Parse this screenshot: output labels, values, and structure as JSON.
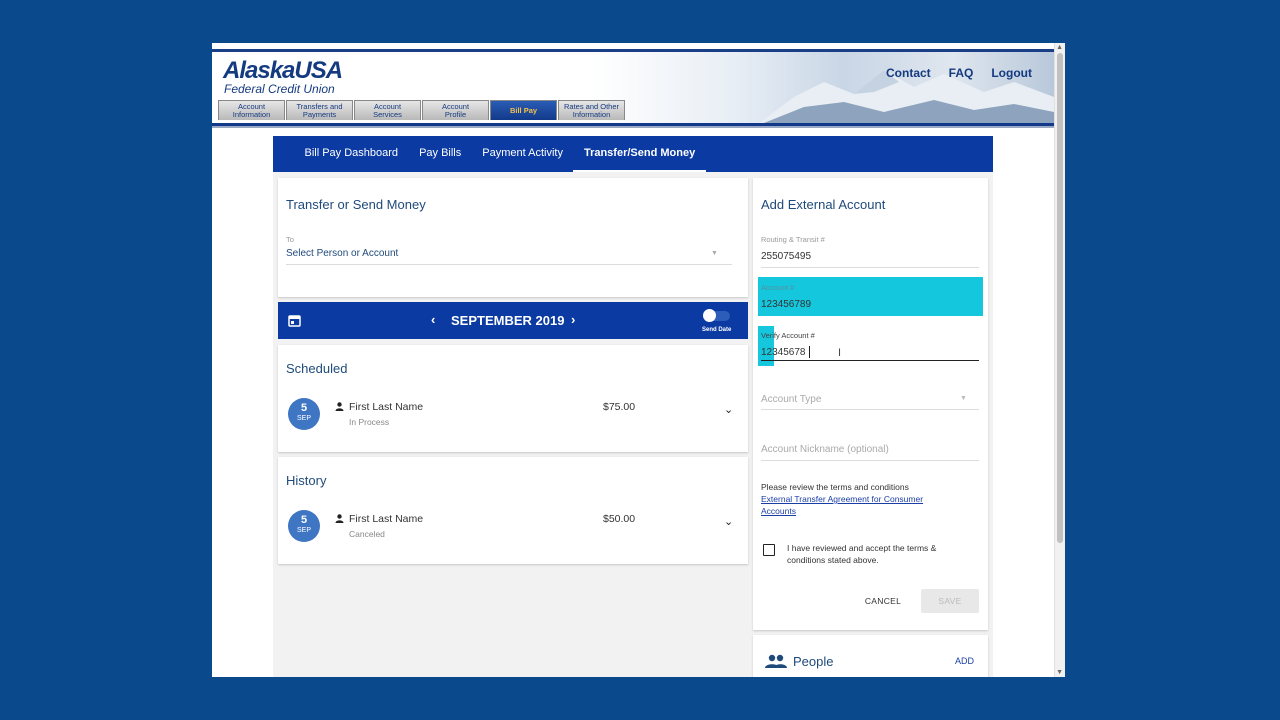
{
  "header": {
    "logo_main": "AlaskaUSA",
    "logo_sub": "Federal Credit Union",
    "links": [
      "Contact",
      "FAQ",
      "Logout"
    ],
    "tabs": [
      "Account\nInformation",
      "Transfers and\nPayments",
      "Account\nServices",
      "Account\nProfile",
      "Bill Pay",
      "Rates and Other\nInformation"
    ]
  },
  "subnav": [
    "Bill Pay Dashboard",
    "Pay Bills",
    "Payment Activity",
    "Transfer/Send Money"
  ],
  "transfer": {
    "title": "Transfer or Send Money",
    "to_label": "To",
    "to_placeholder": "Select Person or Account"
  },
  "calendar": {
    "month": "SEPTEMBER 2019",
    "toggle_label": "Send Date"
  },
  "scheduled": {
    "title": "Scheduled",
    "day": "5",
    "mon": "SEP",
    "name": "First Last Name",
    "status": "In Process",
    "amount": "$75.00"
  },
  "history": {
    "title": "History",
    "day": "5",
    "mon": "SEP",
    "name": "First Last Name",
    "status": "Canceled",
    "amount": "$50.00"
  },
  "external": {
    "title": "Add External Account",
    "routing_label": "Routing & Transit #",
    "routing_value": "255075495",
    "account_label": "Account #",
    "account_value": "123456789",
    "verify_label": "Verify Account #",
    "verify_value": "12345678",
    "type_placeholder": "Account Type",
    "nickname_placeholder": "Account Nickname (optional)",
    "terms_text": "Please review the terms and conditions",
    "terms_link": "External Transfer Agreement for Consumer Accounts",
    "accept_text": "I have reviewed and accept the terms & conditions stated above.",
    "cancel": "CANCEL",
    "save": "SAVE"
  },
  "people": {
    "title": "People",
    "add": "ADD"
  },
  "colors": {
    "page_bg": "#0a4a8c",
    "primary": "#0b3aa3",
    "highlight": "#15c7dd",
    "event_circle": "#3f76c4"
  }
}
